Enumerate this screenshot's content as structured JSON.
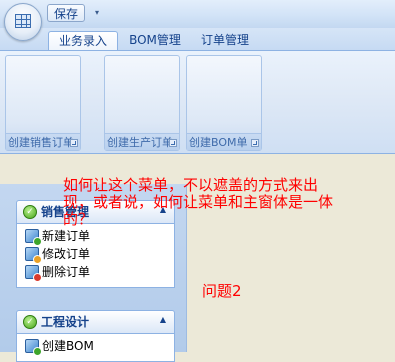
{
  "quick_access": {
    "save_label": "保存",
    "dropdown_glyph": "▾",
    "app_button_icon": "grid-icon"
  },
  "tabs": [
    {
      "label": "业务录入",
      "active": true
    },
    {
      "label": "BOM管理",
      "active": false
    },
    {
      "label": "订单管理",
      "active": false
    }
  ],
  "ribbon": {
    "groups": [
      {
        "label": "创建销售订单"
      },
      {
        "label": "创建生产订单"
      },
      {
        "label": "创建BOM单"
      }
    ]
  },
  "nav": {
    "groups": [
      {
        "title": "销售管理",
        "collapse_glyph": "▲",
        "items": [
          {
            "label": "新建订单",
            "icon": "order-add-icon"
          },
          {
            "label": "修改订单",
            "icon": "order-edit-icon"
          },
          {
            "label": "删除订单",
            "icon": "order-delete-icon"
          }
        ]
      },
      {
        "title": "工程设计",
        "collapse_glyph": "▲",
        "items": [
          {
            "label": "创建BOM",
            "icon": "bom-create-icon"
          }
        ]
      }
    ]
  },
  "annotations": {
    "question1_line1": "如何让这个菜单，不以遮盖的方式来出",
    "question1_line2": "现，或者说，如何让菜单和主窗体是一体",
    "question1_line3": "的？",
    "question2": "问题2"
  },
  "colors": {
    "annotation_red": "#ff0000",
    "ribbon_text": "#15428b",
    "background": "#ece9d8"
  }
}
